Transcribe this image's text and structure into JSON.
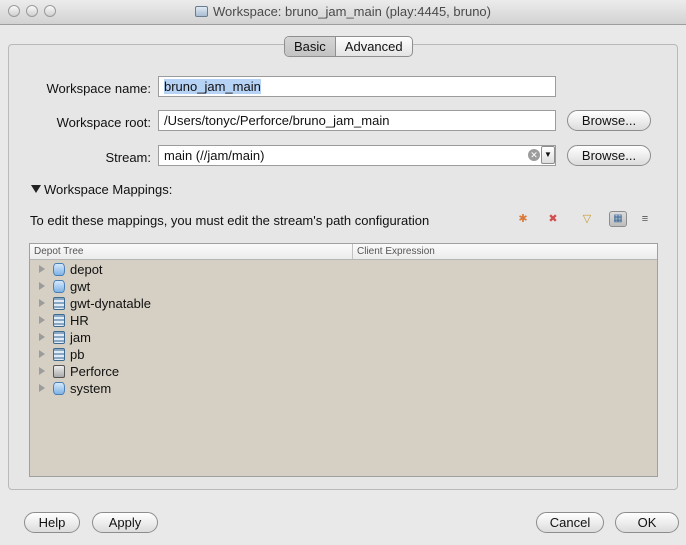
{
  "window": {
    "title": "Workspace: bruno_jam_main (play:4445, bruno)"
  },
  "tabs": {
    "basic": "Basic",
    "advanced": "Advanced"
  },
  "form": {
    "workspace_name_label": "Workspace name:",
    "workspace_name_value": "bruno_jam_main",
    "workspace_root_label": "Workspace root:",
    "workspace_root_value": "/Users/tonyc/Perforce/bruno_jam_main",
    "stream_label": "Stream:",
    "stream_value": "main (//jam/main)",
    "browse_label": "Browse..."
  },
  "mappings": {
    "section_label": "Workspace Mappings:",
    "hint": "To edit these mappings, you must edit the stream's path configuration",
    "columns": [
      "Depot Tree",
      "Client Expression"
    ],
    "items": [
      {
        "name": "depot",
        "icon": "depot-icon"
      },
      {
        "name": "gwt",
        "icon": "depot-icon"
      },
      {
        "name": "gwt-dynatable",
        "icon": "stream-depot-icon"
      },
      {
        "name": "HR",
        "icon": "stream-depot-icon"
      },
      {
        "name": "jam",
        "icon": "stream-depot-icon"
      },
      {
        "name": "pb",
        "icon": "stream-depot-icon"
      },
      {
        "name": "Perforce",
        "icon": "spec-depot-icon"
      },
      {
        "name": "system",
        "icon": "depot-icon"
      }
    ]
  },
  "buttons": {
    "help": "Help",
    "apply": "Apply",
    "cancel": "Cancel",
    "ok": "OK"
  }
}
